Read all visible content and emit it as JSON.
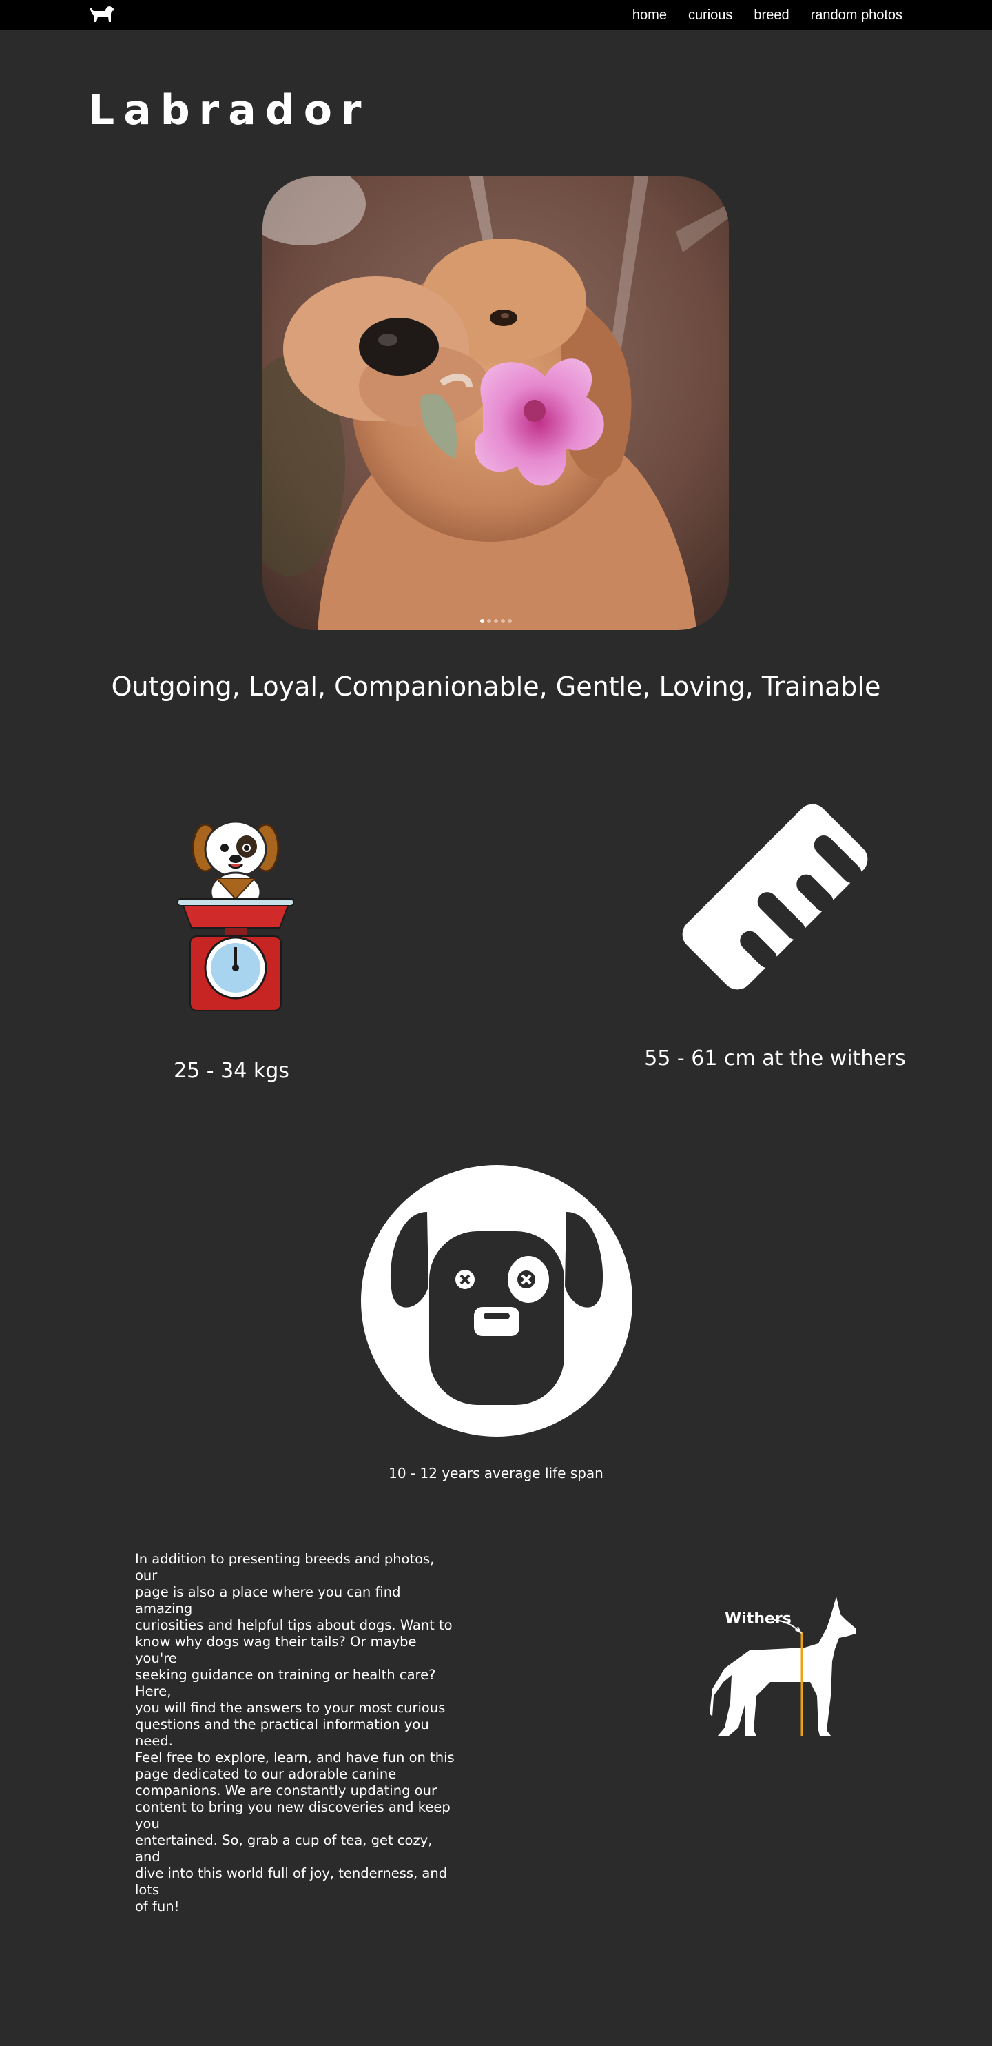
{
  "nav": {
    "logo_icon": "dog-silhouette-icon",
    "links": [
      {
        "label": "home"
      },
      {
        "label": "curious"
      },
      {
        "label": "breed"
      },
      {
        "label": "random photos"
      }
    ]
  },
  "breed": {
    "name": "Labrador",
    "temperament": "Outgoing, Loyal, Companionable, Gentle, Loving, Trainable"
  },
  "carousel": {
    "photo": "golden-dog-holding-pink-flower",
    "slide_count": 5,
    "active_slide": 1
  },
  "stats": {
    "weight": {
      "icon": "dog-on-scale-icon",
      "label": "25 - 34 kgs"
    },
    "height": {
      "icon": "ruler-icon",
      "label": "55 - 61 cm at the withers"
    },
    "lifespan": {
      "icon": "dog-face-circle-icon",
      "label": "10 - 12 years average life span"
    }
  },
  "about": {
    "lines": [
      "In addition to presenting breeds and photos, our",
      "page is also a place where you can find amazing",
      "curiosities and helpful tips about dogs. Want to",
      "know why dogs wag their tails? Or maybe you're",
      "seeking guidance on training or health care? Here,",
      "you will find the answers to your most curious",
      "questions and the practical information you need.",
      "Feel free to explore, learn, and have fun on this",
      "page dedicated to our adorable canine",
      "companions. We are constantly updating our",
      "content to bring you new discoveries and keep you",
      "entertained. So, grab a cup of tea, get cozy, and",
      "dive into this world full of joy, tenderness, and lots",
      "of fun!"
    ]
  },
  "withers_diagram": {
    "label": "Withers",
    "icon": "dog-withers-diagram-icon",
    "accent_color": "#e8a317"
  },
  "colors": {
    "background": "#2b2b2b",
    "navbar": "#000000",
    "text": "#ffffff"
  }
}
